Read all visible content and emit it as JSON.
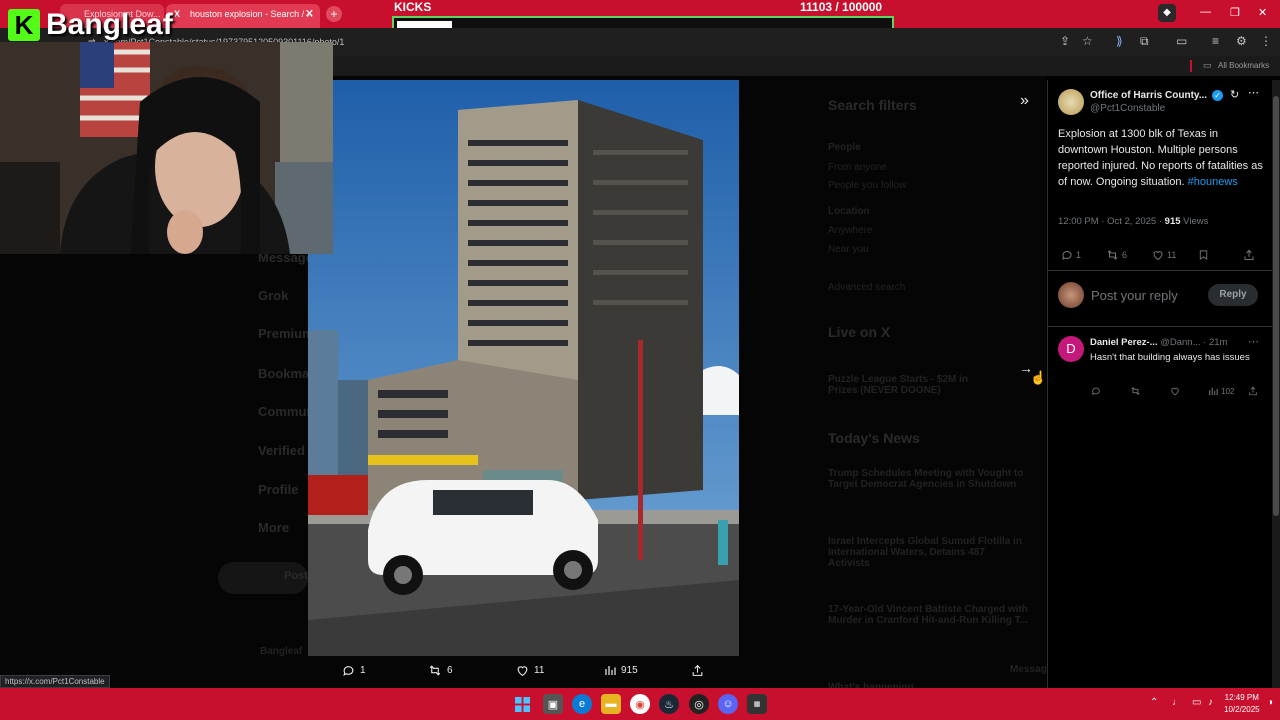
{
  "browser": {
    "tabs": [
      {
        "label": "Explosion at Dow..."
      },
      {
        "label": "houston explosion - Search / X"
      }
    ],
    "url": "x.com/Pct1Constable/status/1973795120509301116/photo/1",
    "all_bookmarks": "All Bookmarks",
    "status_url": "https://x.com/Pct1Constable"
  },
  "overlay": {
    "kicks_label": "KICKS",
    "kicks_count": "11103  / 100000",
    "kicks_progress": 0.111,
    "streamer_logo": "Bangleaf",
    "accent": "#53fc18",
    "bar_color": "#c8102e"
  },
  "background_page": {
    "nav": [
      "Messages",
      "Grok",
      "Premium",
      "Bookmarks",
      "Communities",
      "Verified Orgs",
      "Profile",
      "More"
    ],
    "post_button": "Post",
    "search_filters_title": "Search filters",
    "filters": [
      "People",
      "From anyone",
      "People you follow",
      "Location",
      "Anywhere",
      "Near you"
    ],
    "advanced": "Advanced search",
    "live_title": "Live on X",
    "live_item": "Puzzle League Starts - $2M in Prizes (NEVER DOONE)",
    "news_title": "Today's News",
    "news": [
      "Trump Schedules Meeting with Vought to Target Democrat Agencies in Shutdown",
      "Israel Intercepts Global Sumud Flotilla in International Waters, Detains 487 Activists",
      "17-Year-Old Vincent Battiste Charged with Murder in Cranford Hit-and-Run Killing T..."
    ],
    "whats_happening": "What's happening",
    "messages": "Messages",
    "bottom_user": "Bangleaf"
  },
  "photo_actions": {
    "replies": "1",
    "reposts": "6",
    "likes": "11",
    "views": "915"
  },
  "tweet": {
    "author": "Office of Harris County...",
    "handle": "@Pct1Constable",
    "text": "Explosion at 1300 blk of Texas in downtown Houston. Multiple persons reported injured. No reports of fatalities as of now. Ongoing situation.",
    "hashtag": "#hounews",
    "time": "12:00 PM · Oct 2, 2025 · ",
    "views_count": "915",
    "views_label": " Views",
    "replies": "1",
    "reposts": "6",
    "likes": "11",
    "reply_placeholder": "Post your reply",
    "reply_button": "Reply"
  },
  "reply_post": {
    "avatar_letter": "D",
    "author": "Daniel Perez-...",
    "handle": "@Dann...",
    "age": "· 21m",
    "text": "Hasn't that building always has issues",
    "views": "102"
  },
  "taskbar": {
    "time": "12:49 PM",
    "date": "10/2/2025"
  }
}
